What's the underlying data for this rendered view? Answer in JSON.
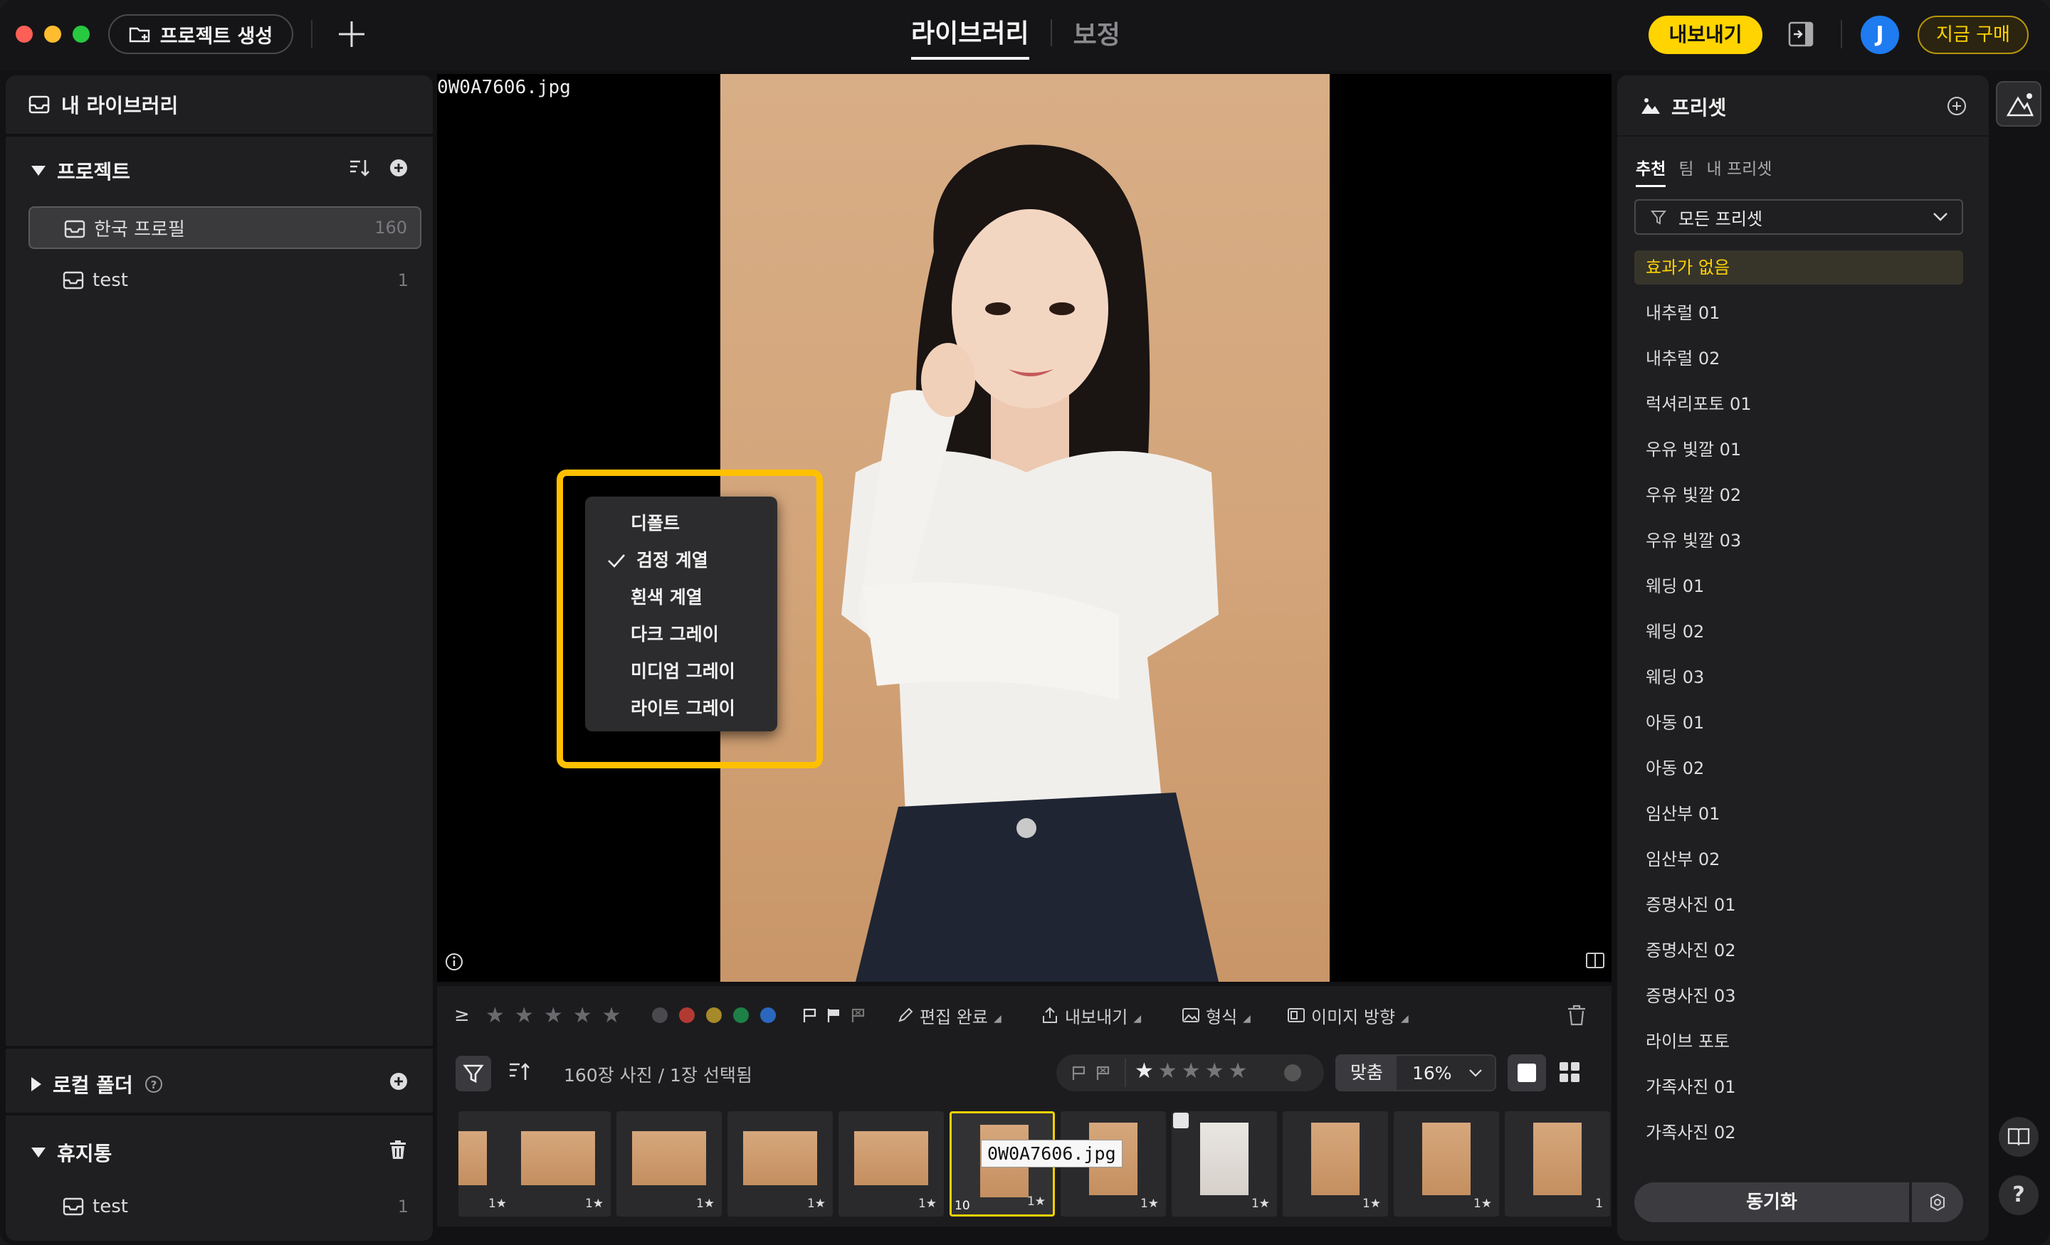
{
  "titlebar": {
    "new_project_label": "프로젝트 생성",
    "mode_tabs": [
      {
        "label": "라이브러리",
        "active": true
      },
      {
        "label": "보정",
        "active": false
      }
    ],
    "export_label": "내보내기",
    "avatar_initial": "J",
    "buy_label": "지금 구매"
  },
  "left_panel": {
    "library_title": "내 라이브러리",
    "projects_title": "프로젝트",
    "projects": [
      {
        "label": "한국 프로필",
        "count": "160",
        "selected": true
      },
      {
        "label": "test",
        "count": "1",
        "selected": false
      }
    ],
    "local_folder_title": "로컬 폴더",
    "trash_title": "휴지통",
    "trash_items": [
      {
        "label": "test",
        "count": "1"
      }
    ]
  },
  "viewer": {
    "file_name": "0W0A7606.jpg"
  },
  "context_menu": {
    "items": [
      {
        "label": "디폴트",
        "checked": false
      },
      {
        "label": "검정 계열",
        "checked": true
      },
      {
        "label": "흰색 계열",
        "checked": false
      },
      {
        "label": "다크 그레이",
        "checked": false
      },
      {
        "label": "미디엄 그레이",
        "checked": false
      },
      {
        "label": "라이트 그레이",
        "checked": false
      }
    ],
    "highlight_color": "#ffc000"
  },
  "toolbar": {
    "gte_symbol": "≥",
    "color_labels": [
      "#5a5a5e",
      "#c0392b",
      "#b8942a",
      "#1e8a4a",
      "#2a6fc9"
    ],
    "edit_done_label": "편집 완료",
    "export_label": "내보내기",
    "format_label": "형식",
    "orientation_label": "이미지 방향"
  },
  "strip_bar": {
    "count_label": "160장 사진 / 1장 선택됨",
    "zoom_fit_label": "맞춤",
    "zoom_value": "16%"
  },
  "filmstrip": {
    "thumbs": [
      {
        "rating": "1★",
        "orientation": "landscape",
        "selected": false,
        "num": ""
      },
      {
        "rating": "1★",
        "orientation": "landscape",
        "selected": false,
        "num": ""
      },
      {
        "rating": "1★",
        "orientation": "landscape",
        "selected": false,
        "num": ""
      },
      {
        "rating": "1★",
        "orientation": "landscape",
        "selected": false,
        "num": ""
      },
      {
        "rating": "1★",
        "orientation": "landscape",
        "selected": false,
        "num": ""
      },
      {
        "rating": "1★",
        "orientation": "portrait",
        "selected": true,
        "num": "10"
      },
      {
        "rating": "1★",
        "orientation": "portrait",
        "selected": false,
        "num": ""
      },
      {
        "rating": "1★",
        "orientation": "portrait",
        "selected": false,
        "num": ""
      },
      {
        "rating": "1★",
        "orientation": "portrait",
        "selected": false,
        "num": ""
      },
      {
        "rating": "1★",
        "orientation": "portrait",
        "selected": false,
        "num": ""
      },
      {
        "rating": "1",
        "orientation": "portrait",
        "selected": false,
        "num": ""
      }
    ],
    "tooltip": "0W0A7606.jpg"
  },
  "right_panel": {
    "title": "프리셋",
    "tabs": [
      {
        "label": "추천",
        "active": true
      },
      {
        "label": "팀",
        "active": false
      },
      {
        "label": "내 프리셋",
        "active": false
      }
    ],
    "filter_label": "모든 프리셋",
    "presets": [
      {
        "label": "효과가 없음",
        "active": true
      },
      {
        "label": "내추럴 01"
      },
      {
        "label": "내추럴 02"
      },
      {
        "label": "럭셔리포토 01"
      },
      {
        "label": "우유 빛깔 01"
      },
      {
        "label": "우유 빛깔 02"
      },
      {
        "label": "우유 빛깔 03"
      },
      {
        "label": "웨딩 01"
      },
      {
        "label": "웨딩 02"
      },
      {
        "label": "웨딩 03"
      },
      {
        "label": "아동 01"
      },
      {
        "label": "아동 02"
      },
      {
        "label": "임산부 01"
      },
      {
        "label": "임산부 02"
      },
      {
        "label": "증명사진 01"
      },
      {
        "label": "증명사진 02"
      },
      {
        "label": "증명사진 03"
      },
      {
        "label": "라이브 포토"
      },
      {
        "label": "가족사진 01"
      },
      {
        "label": "가족사진 02"
      }
    ],
    "sync_label": "동기화"
  },
  "rail": {
    "help_label": "?"
  },
  "colors": {
    "accent": "#ffd400",
    "avatar": "#1e7bf0",
    "background": "#121214",
    "panel": "#1f1f21"
  }
}
